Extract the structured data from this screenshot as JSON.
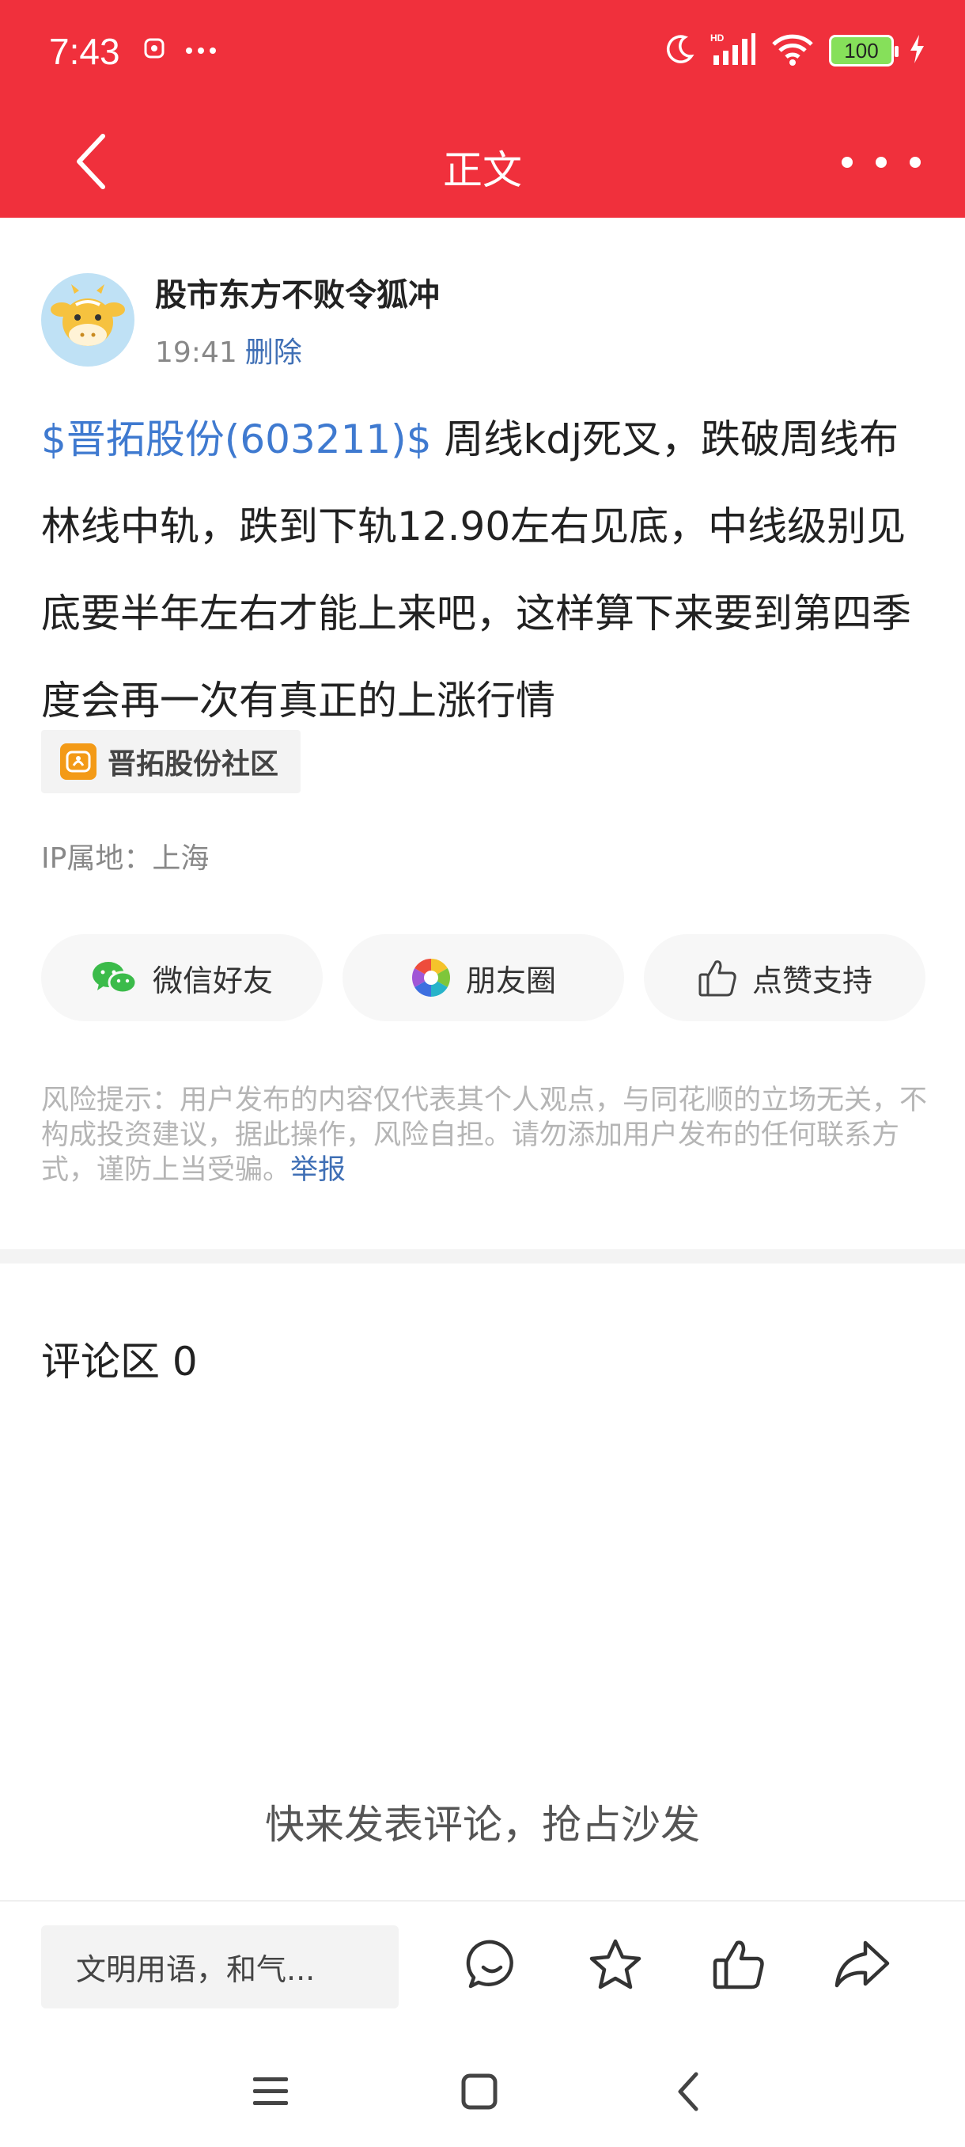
{
  "status_bar": {
    "time": "7:43",
    "battery": "100",
    "icons": [
      "screen-record-icon",
      "more-dots-icon",
      "moon-icon",
      "signal-icon",
      "wifi-icon",
      "battery-icon",
      "charging-icon"
    ],
    "background_color": "#f0303c"
  },
  "nav": {
    "title": "正文",
    "back_icon": "back-arrow-icon",
    "more_icon": "more-icon"
  },
  "author": {
    "name": "股市东方不败令狐冲",
    "time": "19:41",
    "delete_label": "删除"
  },
  "post": {
    "stock_link": "$晋拓股份(603211)$",
    "text": " 周线kdj死叉，跌破周线布林线中轨，跌到下轨12.90左右见底，中线级别见底要半年左右才能上来吧，这样算下来要到第四季度会再一次有真正的上涨行情",
    "link_color": "#3f7ad0"
  },
  "community": {
    "label": "晋拓股份社区"
  },
  "ip_location": "IP属地：上海",
  "share": [
    {
      "label": "微信好友",
      "icon": "wechat-icon"
    },
    {
      "label": "朋友圈",
      "icon": "moments-icon"
    },
    {
      "label": "点赞支持",
      "icon": "thumbs-up-icon"
    }
  ],
  "disclaimer": {
    "text": "风险提示：用户发布的内容仅代表其个人观点，与同花顺的立场无关，不构成投资建议，据此操作，风险自担。请勿添加用户发布的任何联系方式，谨防上当受骗。",
    "report_label": "举报"
  },
  "comments": {
    "title": "评论区 0",
    "empty_text": "快来发表评论，抢占沙发"
  },
  "bottom_bar": {
    "input_placeholder": "文明用语，和气...",
    "actions": [
      "comment-icon",
      "star-icon",
      "thumbs-up-icon",
      "share-icon"
    ]
  },
  "system_nav": [
    "menu-icon",
    "home-icon",
    "back-icon"
  ]
}
